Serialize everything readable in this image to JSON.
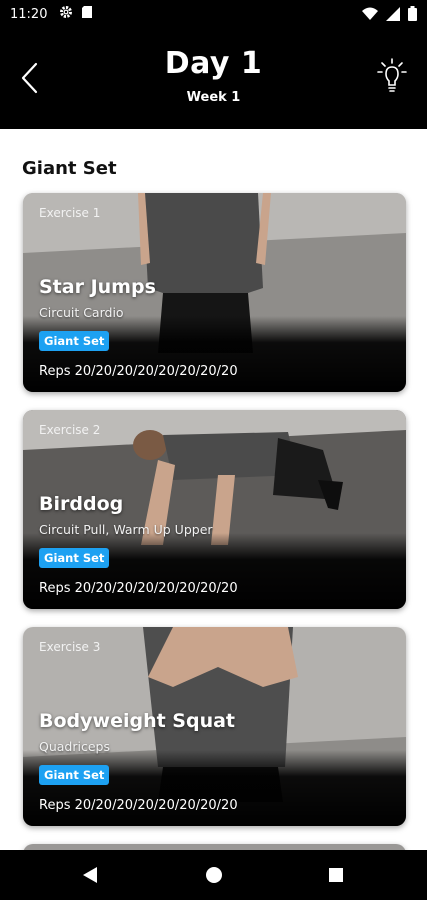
{
  "status_bar": {
    "time": "11:20"
  },
  "header": {
    "title": "Day 1",
    "subtitle": "Week 1"
  },
  "section": {
    "title": "Giant Set"
  },
  "exercises": [
    {
      "number": "Exercise 1",
      "name": "Star Jumps",
      "category": "Circuit Cardio",
      "badge": "Giant Set",
      "reps": "Reps 20/20/20/20/20/20/20/20"
    },
    {
      "number": "Exercise 2",
      "name": "Birddog",
      "category": "Circuit Pull, Warm Up Upper",
      "badge": "Giant Set",
      "reps": "Reps 20/20/20/20/20/20/20/20"
    },
    {
      "number": "Exercise 3",
      "name": "Bodyweight Squat",
      "category": "Quadriceps",
      "badge": "Giant Set",
      "reps": "Reps 20/20/20/20/20/20/20/20"
    }
  ],
  "icons": {
    "back": "chevron-left-icon",
    "tips": "lightbulb-icon",
    "status": [
      "gear-icon",
      "sd-card-icon",
      "wifi-icon",
      "signal-icon",
      "battery-icon"
    ],
    "nav": [
      "nav-back-icon",
      "nav-home-icon",
      "nav-recents-icon"
    ]
  },
  "colors": {
    "badge": "#1da1f2",
    "header_bg": "#000000"
  }
}
